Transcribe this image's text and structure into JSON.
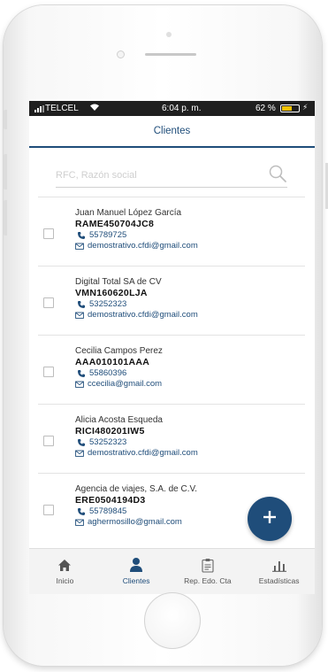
{
  "status_bar": {
    "carrier": "TELCEL",
    "time": "6:04 p. m.",
    "battery_percent": "62 %",
    "battery_level": 0.62,
    "wifi_icon": "wifi-icon",
    "charging_icon": "bolt-icon"
  },
  "header": {
    "title": "Clientes"
  },
  "search": {
    "placeholder": "RFC, Razón social",
    "value": "",
    "icon": "search-icon"
  },
  "clients": [
    {
      "name": "Juan Manuel López García",
      "rfc": "RAME450704JC8",
      "phone": "55789725",
      "email": "demostrativo.cfdi@gmail.com"
    },
    {
      "name": "Digital Total SA de CV",
      "rfc": "VMN160620LJA",
      "phone": "53252323",
      "email": "demostrativo.cfdi@gmail.com"
    },
    {
      "name": "Cecilia Campos Perez",
      "rfc": "AAA010101AAA",
      "phone": "55860396",
      "email": "ccecilia@gmail.com"
    },
    {
      "name": "Alicia Acosta Esqueda",
      "rfc": "RICI480201IW5",
      "phone": "53252323",
      "email": "demostrativo.cfdi@gmail.com"
    },
    {
      "name": "Agencia de viajes, S.A. de C.V.",
      "rfc": "ERE0504194D3",
      "phone": "55789845",
      "email": "aghermosillo@gmail.com"
    }
  ],
  "fab": {
    "icon": "plus-icon"
  },
  "tabs": [
    {
      "label": "Inicio",
      "icon": "home-icon",
      "active": false
    },
    {
      "label": "Clientes",
      "icon": "person-icon",
      "active": true
    },
    {
      "label": "Rep. Edo. Cta",
      "icon": "clipboard-icon",
      "active": false
    },
    {
      "label": "Estadísticas",
      "icon": "bar-chart-icon",
      "active": false
    }
  ],
  "colors": {
    "accent": "#1f4d7a",
    "status_bar": "#1f1f1f",
    "battery": "#f2c200",
    "tab_bar": "#f3f3f3"
  }
}
